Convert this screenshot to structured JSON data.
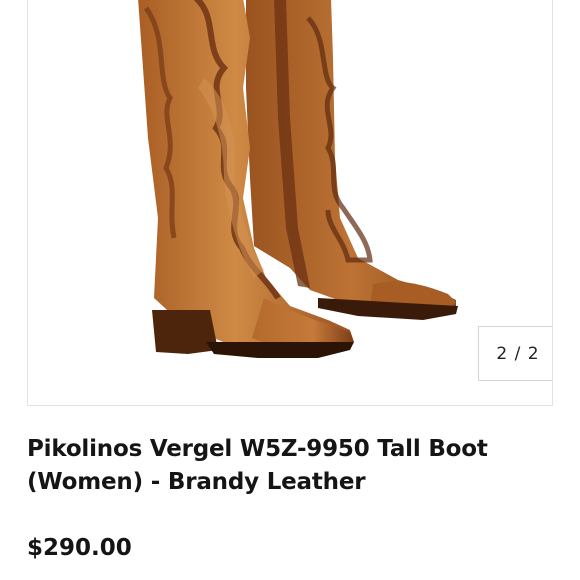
{
  "product": {
    "image_alt": "Brandy leather tall western boots",
    "gallery_counter": "2 / 2",
    "title": "Pikolinos Vergel W5Z-9950 Tall Boot (Women) - Brandy Leather",
    "price": "$290.00"
  },
  "colors": {
    "leather_light": "#b86a2e",
    "leather_dark": "#6e3515",
    "text": "#151515"
  }
}
